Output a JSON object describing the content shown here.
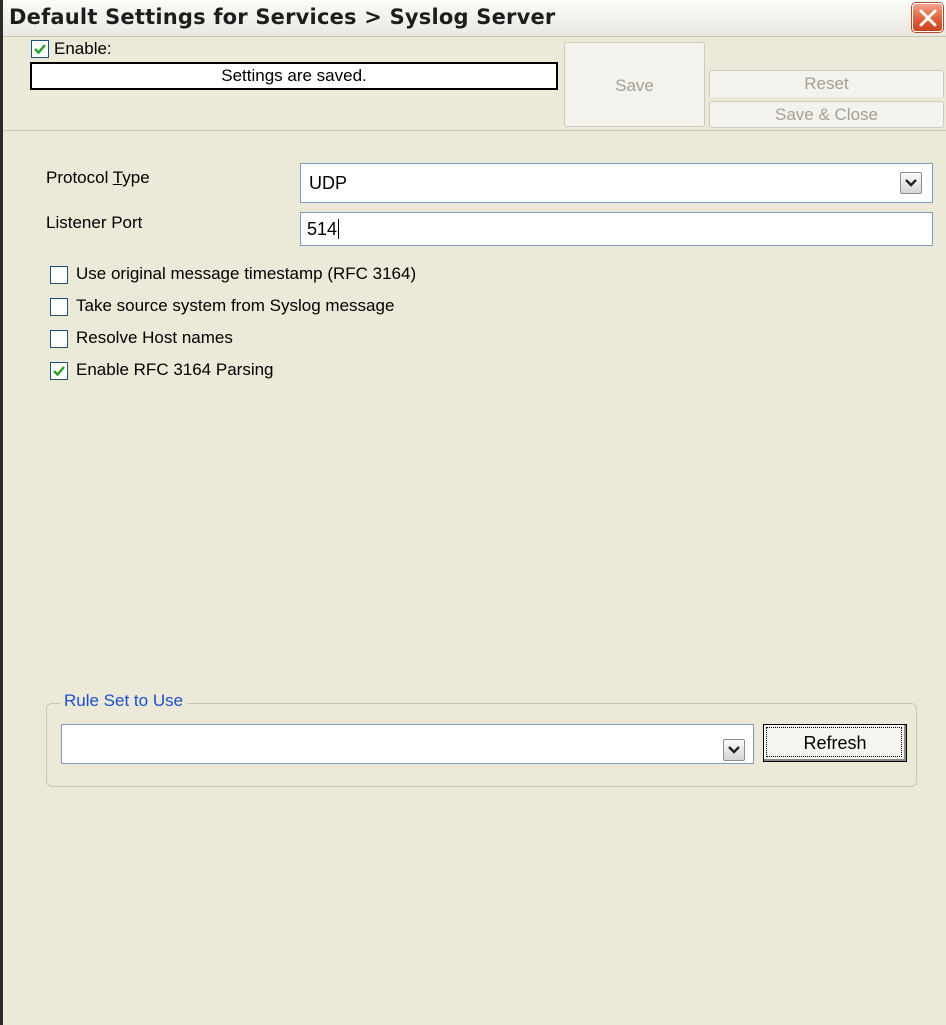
{
  "window": {
    "title": "Default Settings for Services > Syslog Server",
    "close_icon": "close-icon"
  },
  "toolbar": {
    "enable_label": "Enable:",
    "enable_checked": true,
    "status_text": "Settings are saved.",
    "save_label": "Save",
    "reset_label": "Reset",
    "save_close_label": "Save & Close"
  },
  "form": {
    "protocol_label_pre": "Protocol ",
    "protocol_label_accel": "T",
    "protocol_label_post": "ype",
    "protocol_value": "UDP",
    "port_label": "Listener Port",
    "port_value": "514"
  },
  "options": [
    {
      "label": "Use original message timestamp (RFC 3164)",
      "checked": false
    },
    {
      "label": "Take source system from Syslog message",
      "checked": false
    },
    {
      "label": "Resolve Host names",
      "checked": false
    },
    {
      "label": "Enable RFC 3164 Parsing",
      "checked": true
    }
  ],
  "ruleset": {
    "legend": "Rule Set to Use",
    "value": "",
    "refresh_label": "Refresh"
  },
  "colors": {
    "accent_check": "#21a121",
    "legend_blue": "#1a4fd0",
    "close_red": "#e0603b"
  }
}
